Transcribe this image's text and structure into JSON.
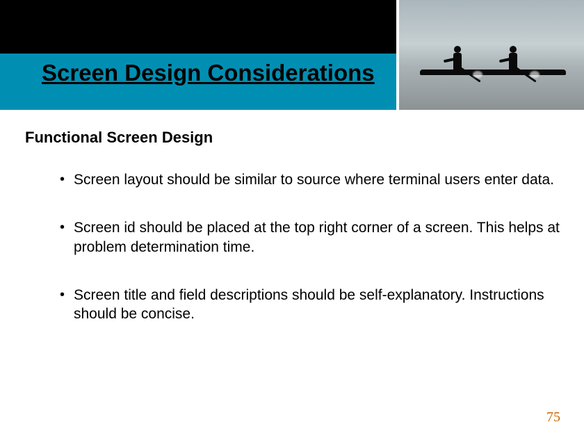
{
  "slide": {
    "title": "Screen Design Considerations",
    "subtitle": "Functional Screen Design",
    "bullets": [
      "Screen layout should be similar to source where terminal users enter data.",
      "Screen id should be placed at the top right corner of a screen. This helps at problem determination time.",
      "Screen title and field descriptions should be self-explanatory. Instructions should be concise."
    ],
    "page_number": "75"
  }
}
